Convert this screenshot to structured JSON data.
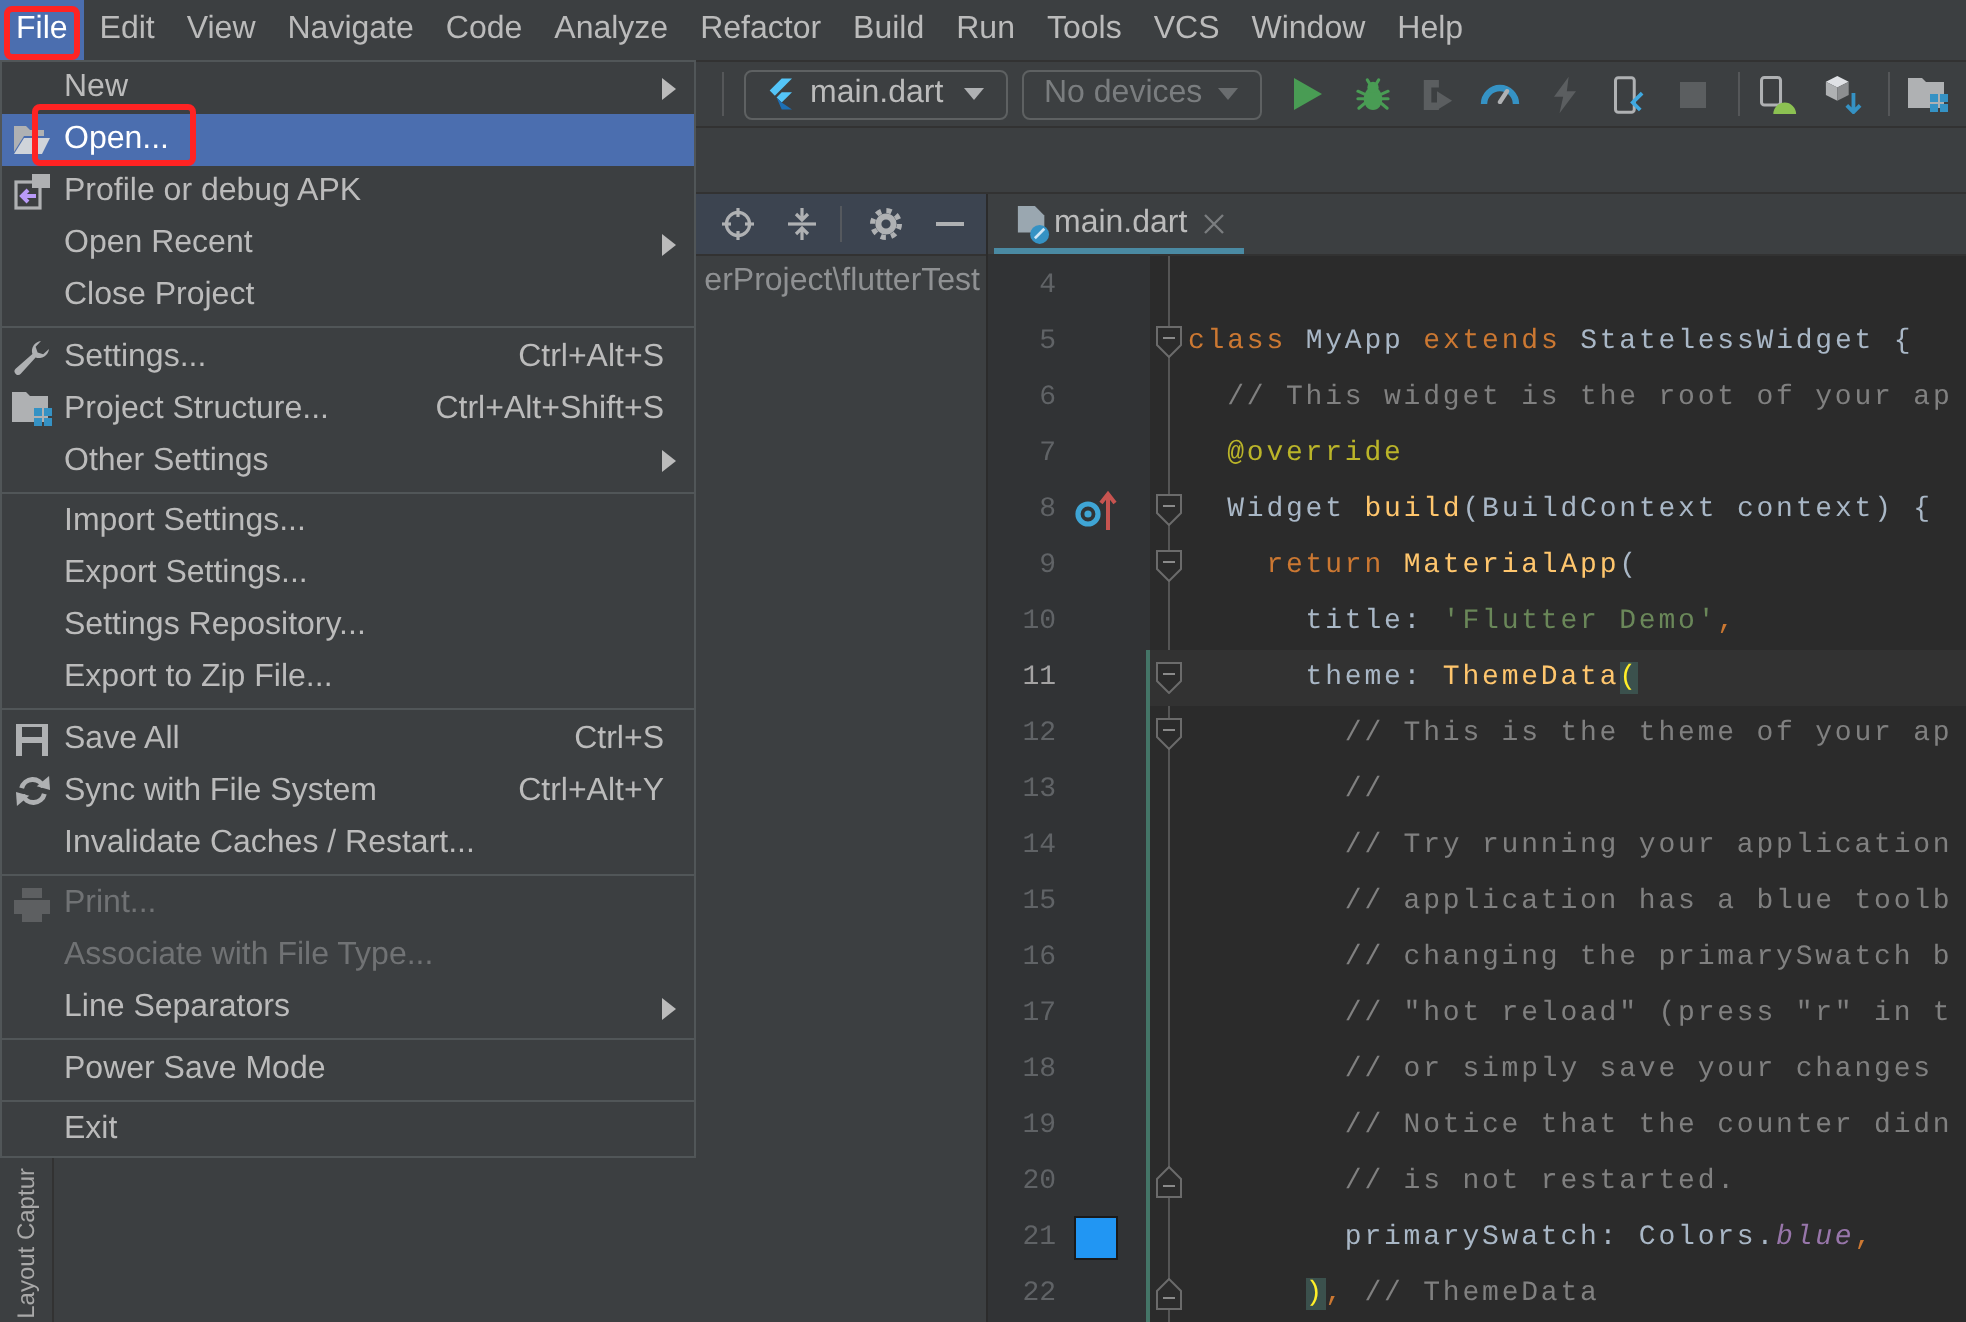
{
  "menubar": [
    {
      "label": "File",
      "selected": true,
      "marked": true
    },
    {
      "label": "Edit",
      "selected": false,
      "marked": false
    },
    {
      "label": "View",
      "selected": false,
      "marked": false
    },
    {
      "label": "Navigate",
      "selected": false,
      "marked": false
    },
    {
      "label": "Code",
      "selected": false,
      "marked": false
    },
    {
      "label": "Analyze",
      "selected": false,
      "marked": false
    },
    {
      "label": "Refactor",
      "selected": false,
      "marked": false
    },
    {
      "label": "Build",
      "selected": false,
      "marked": false
    },
    {
      "label": "Run",
      "selected": false,
      "marked": false
    },
    {
      "label": "Tools",
      "selected": false,
      "marked": false
    },
    {
      "label": "VCS",
      "selected": false,
      "marked": false
    },
    {
      "label": "Window",
      "selected": false,
      "marked": false
    },
    {
      "label": "Help",
      "selected": false,
      "marked": false
    }
  ],
  "toolbar": {
    "run_config": {
      "label": "main.dart"
    },
    "device": {
      "label": "No devices",
      "disabled": true
    },
    "button_groups": [
      [
        {
          "disabled": false
        },
        {
          "disabled": false
        },
        {
          "disabled": true
        },
        {
          "disabled": false
        },
        {
          "disabled": true
        },
        {
          "disabled": false
        },
        {
          "disabled": true
        }
      ],
      [
        {
          "disabled": false
        },
        {
          "disabled": false
        }
      ],
      [
        {
          "disabled": false
        }
      ]
    ]
  },
  "file_menu": {
    "groups": [
      [
        {
          "label": "New",
          "submenu": true,
          "disabled": false,
          "selected": false,
          "marked": false
        },
        {
          "label": "Open...",
          "submenu": false,
          "disabled": false,
          "selected": true,
          "marked": true
        },
        {
          "label": "Profile or debug APK",
          "submenu": false,
          "disabled": false,
          "selected": false,
          "marked": false
        },
        {
          "label": "Open Recent",
          "submenu": true,
          "disabled": false,
          "selected": false,
          "marked": false
        },
        {
          "label": "Close Project",
          "submenu": false,
          "disabled": false,
          "selected": false,
          "marked": false
        }
      ],
      [
        {
          "label": "Settings...",
          "shortcut": "Ctrl+Alt+S",
          "submenu": false,
          "disabled": false,
          "selected": false,
          "marked": false
        },
        {
          "label": "Project Structure...",
          "shortcut": "Ctrl+Alt+Shift+S",
          "submenu": false,
          "disabled": false,
          "selected": false,
          "marked": false
        },
        {
          "label": "Other Settings",
          "submenu": true,
          "disabled": false,
          "selected": false,
          "marked": false
        }
      ],
      [
        {
          "label": "Import Settings...",
          "submenu": false,
          "disabled": false,
          "selected": false,
          "marked": false
        },
        {
          "label": "Export Settings...",
          "submenu": false,
          "disabled": false,
          "selected": false,
          "marked": false
        },
        {
          "label": "Settings Repository...",
          "submenu": false,
          "disabled": false,
          "selected": false,
          "marked": false
        },
        {
          "label": "Export to Zip File...",
          "submenu": false,
          "disabled": false,
          "selected": false,
          "marked": false
        }
      ],
      [
        {
          "label": "Save All",
          "shortcut": "Ctrl+S",
          "submenu": false,
          "disabled": false,
          "selected": false,
          "marked": false
        },
        {
          "label": "Sync with File System",
          "shortcut": "Ctrl+Alt+Y",
          "submenu": false,
          "disabled": false,
          "selected": false,
          "marked": false
        },
        {
          "label": "Invalidate Caches / Restart...",
          "submenu": false,
          "disabled": false,
          "selected": false,
          "marked": false
        }
      ],
      [
        {
          "label": "Print...",
          "submenu": false,
          "disabled": true,
          "selected": false,
          "marked": false
        },
        {
          "label": "Associate with File Type...",
          "submenu": false,
          "disabled": true,
          "selected": false,
          "marked": false
        },
        {
          "label": "Line Separators",
          "submenu": true,
          "disabled": false,
          "selected": false,
          "marked": false
        }
      ],
      [
        {
          "label": "Power Save Mode",
          "submenu": false,
          "disabled": false,
          "selected": false,
          "marked": false
        }
      ],
      [
        {
          "label": "Exit",
          "submenu": false,
          "disabled": false,
          "selected": false,
          "marked": false
        }
      ]
    ]
  },
  "tool_stripe": {
    "label": "Layout Captur"
  },
  "project_panel": {
    "path": "erProject\\flutterTest"
  },
  "editor": {
    "tabs": [
      {
        "label": "main.dart",
        "selected": true
      }
    ],
    "lines": [
      {
        "number": "4",
        "current": false,
        "changed": false,
        "fold_start": false,
        "fold_end": false
      },
      {
        "number": "5",
        "current": false,
        "changed": false,
        "fold_start": true,
        "fold_end": false,
        "tokens": [
          {
            "text": "class",
            "kind": "keyword"
          },
          {
            "text": " MyApp ",
            "kind": "plain"
          },
          {
            "text": "extends",
            "kind": "keyword"
          },
          {
            "text": " StatelessWidget {",
            "kind": "plain"
          }
        ],
        "children": [
          {
            "number": "6",
            "current": false,
            "changed": false,
            "fold_start": false,
            "fold_end": false,
            "tokens": [
              {
                "text": "// This widget is the root of your ap",
                "kind": "comment"
              }
            ]
          },
          {
            "number": "7",
            "current": false,
            "changed": false,
            "fold_start": false,
            "fold_end": false,
            "tokens": [
              {
                "text": "@override",
                "kind": "annotation"
              }
            ]
          },
          {
            "number": "8",
            "current": false,
            "changed": false,
            "fold_start": true,
            "fold_end": false,
            "gutter": {
              "kind": "override"
            },
            "tokens": [
              {
                "text": "Widget ",
                "kind": "plain"
              },
              {
                "text": "build",
                "kind": "function"
              },
              {
                "text": "(BuildContext context) {",
                "kind": "plain"
              }
            ],
            "children": [
              {
                "number": "9",
                "current": false,
                "changed": false,
                "fold_start": true,
                "fold_end": false,
                "tokens": [
                  {
                    "text": "return ",
                    "kind": "keyword"
                  },
                  {
                    "text": "MaterialApp",
                    "kind": "function"
                  },
                  {
                    "text": "(",
                    "kind": "plain"
                  }
                ],
                "children": [
                  {
                    "number": "10",
                    "current": false,
                    "changed": false,
                    "fold_start": false,
                    "fold_end": false,
                    "tokens": [
                      {
                        "text": "title: ",
                        "kind": "plain"
                      },
                      {
                        "text": "'Flutter Demo'",
                        "kind": "string"
                      },
                      {
                        "text": ",",
                        "kind": "keyword"
                      }
                    ]
                  },
                  {
                    "number": "11",
                    "current": true,
                    "changed": true,
                    "fold_start": true,
                    "fold_end": false,
                    "tokens": [
                      {
                        "text": "theme: ",
                        "kind": "plain"
                      },
                      {
                        "text": "ThemeData",
                        "kind": "function"
                      },
                      {
                        "text": "(",
                        "kind": "bracket"
                      }
                    ],
                    "children": [
                      {
                        "number": "12",
                        "current": false,
                        "changed": true,
                        "fold_start": true,
                        "fold_end": false,
                        "tokens": [
                          {
                            "text": "// This is the theme of your ap",
                            "kind": "comment"
                          }
                        ]
                      },
                      {
                        "number": "13",
                        "current": false,
                        "changed": true,
                        "fold_start": false,
                        "fold_end": false,
                        "tokens": [
                          {
                            "text": "//",
                            "kind": "comment"
                          }
                        ]
                      },
                      {
                        "number": "14",
                        "current": false,
                        "changed": true,
                        "fold_start": false,
                        "fold_end": false,
                        "tokens": [
                          {
                            "text": "// Try running your application",
                            "kind": "comment"
                          }
                        ]
                      },
                      {
                        "number": "15",
                        "current": false,
                        "changed": true,
                        "fold_start": false,
                        "fold_end": false,
                        "tokens": [
                          {
                            "text": "// application has a blue toolb",
                            "kind": "comment"
                          }
                        ]
                      },
                      {
                        "number": "16",
                        "current": false,
                        "changed": true,
                        "fold_start": false,
                        "fold_end": false,
                        "tokens": [
                          {
                            "text": "// changing the primarySwatch b",
                            "kind": "comment"
                          }
                        ]
                      },
                      {
                        "number": "17",
                        "current": false,
                        "changed": true,
                        "fold_start": false,
                        "fold_end": false,
                        "tokens": [
                          {
                            "text": "// \"hot reload\" (press \"r\" in t",
                            "kind": "comment"
                          }
                        ]
                      },
                      {
                        "number": "18",
                        "current": false,
                        "changed": true,
                        "fold_start": false,
                        "fold_end": false,
                        "tokens": [
                          {
                            "text": "// or simply save your changes",
                            "kind": "comment"
                          }
                        ]
                      },
                      {
                        "number": "19",
                        "current": false,
                        "changed": true,
                        "fold_start": false,
                        "fold_end": false,
                        "tokens": [
                          {
                            "text": "// Notice that the counter didn",
                            "kind": "comment"
                          }
                        ]
                      },
                      {
                        "number": "20",
                        "current": false,
                        "changed": true,
                        "fold_start": false,
                        "fold_end": true,
                        "tokens": [
                          {
                            "text": "// is not restarted.",
                            "kind": "comment"
                          }
                        ]
                      },
                      {
                        "number": "21",
                        "current": false,
                        "changed": true,
                        "fold_start": false,
                        "fold_end": false,
                        "gutter": {
                          "kind": "swatch",
                          "color": "#2196f3"
                        },
                        "tokens": [
                          {
                            "text": "primarySwatch: Colors.",
                            "kind": "plain"
                          },
                          {
                            "text": "blue",
                            "kind": "constant"
                          },
                          {
                            "text": ",",
                            "kind": "keyword"
                          }
                        ]
                      }
                    ]
                  },
                  {
                    "number": "22",
                    "current": false,
                    "changed": true,
                    "fold_start": false,
                    "fold_end": true,
                    "tokens": [
                      {
                        "text": ")",
                        "kind": "bracket"
                      },
                      {
                        "text": ",",
                        "kind": "keyword"
                      },
                      {
                        "text": " // ThemeData",
                        "kind": "comment"
                      }
                    ]
                  }
                ]
              }
            ]
          }
        ]
      }
    ]
  }
}
